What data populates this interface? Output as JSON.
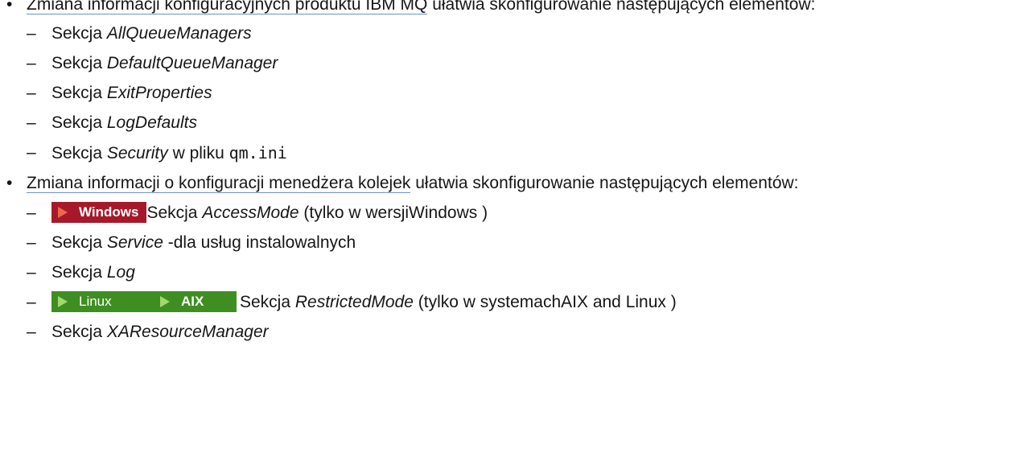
{
  "items": [
    {
      "link": "Zmiana informacji konfiguracyjnych produktu IBM MQ",
      "text": " ułatwia skonfigurowanie następujących elementów:",
      "sub": [
        {
          "prefix": "Sekcja ",
          "name": "AllQueueManagers"
        },
        {
          "prefix": "Sekcja ",
          "name": "DefaultQueueManager"
        },
        {
          "prefix": "Sekcja ",
          "name": "ExitProperties"
        },
        {
          "prefix": "Sekcja ",
          "name": "LogDefaults"
        },
        {
          "prefix": "Sekcja ",
          "name": "Security",
          "suffix": " w pliku ",
          "code": "qm.ini"
        }
      ]
    },
    {
      "link": "Zmiana informacji o konfiguracji menedżera kolejek",
      "text": " ułatwia skonfigurowanie następujących elementów:",
      "sub": [
        {
          "badge": "Windows",
          "prefix": "Sekcja ",
          "name": "AccessMode",
          "suffix": " (tylko w wersjiWindows )"
        },
        {
          "prefix": "Sekcja ",
          "name": "Service",
          "suffix": " -dla usług instalowalnych"
        },
        {
          "prefix": "Sekcja ",
          "name": "Log"
        },
        {
          "badge1": "Linux",
          "badge2": "AIX",
          "prefix": "Sekcja ",
          "name": "RestrictedMode",
          "suffix": " (tylko w systemachAIX and Linux )"
        },
        {
          "prefix": "Sekcja ",
          "name": "XAResourceManager"
        }
      ]
    }
  ],
  "colors": {
    "windows_badge": "#a7192a",
    "platform_badge": "#3e8e22",
    "link_underline": "#6f8fd6"
  }
}
